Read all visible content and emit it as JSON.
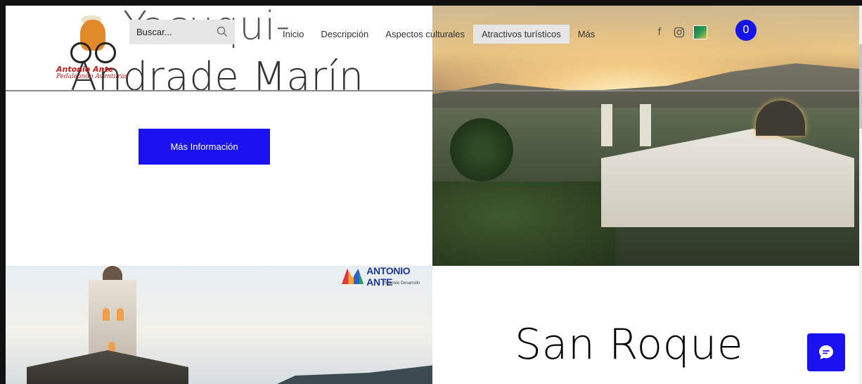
{
  "header": {
    "logo": {
      "brand": "Antonio Ante",
      "tagline": "Pedaleando Aventuras"
    },
    "search": {
      "placeholder": "Buscar..."
    },
    "nav": [
      {
        "label": "Inicio"
      },
      {
        "label": "Descripción"
      },
      {
        "label": "Aspectos culturales"
      },
      {
        "label": "Atractivos turísticos",
        "active": true
      },
      {
        "label": "Más"
      }
    ],
    "social": [
      "facebook-icon",
      "instagram-icon",
      "flag-icon"
    ],
    "cart_count": "0"
  },
  "hero": {
    "title_line1": "Yacuqui-",
    "title_line2": "Andrade Marín",
    "cta_label": "Más Información"
  },
  "bottom_left": {
    "badge_name": "ANTONIO ANTE",
    "badge_sub": "Tejiendo Desarrollo"
  },
  "section_title": "San Roque",
  "colors": {
    "accent": "#1a12f0",
    "nav_active_bg": "#e6e6e6",
    "search_bg": "#e6e6e6"
  }
}
